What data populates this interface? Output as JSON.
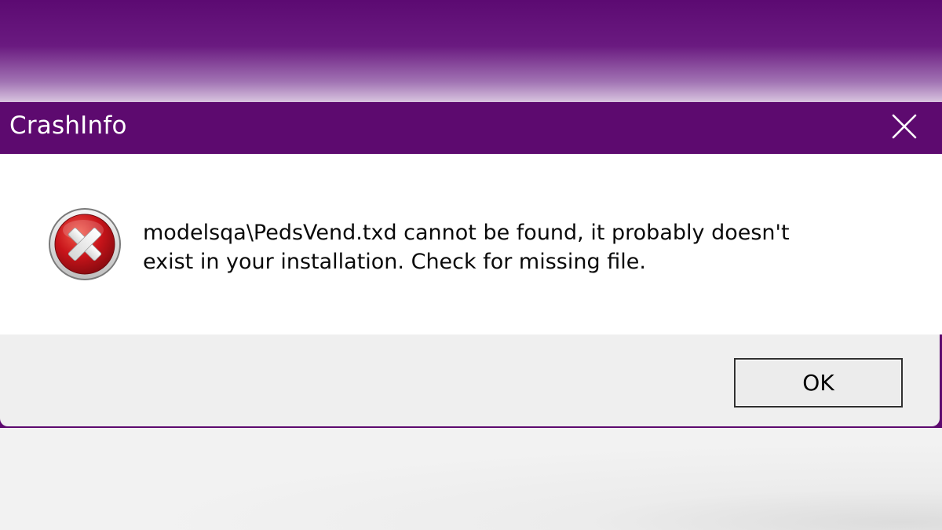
{
  "window": {
    "title": "CrashInfo",
    "close_icon": "close-icon",
    "accent_color": "#5d0a6f"
  },
  "message": {
    "icon": "error-icon",
    "text": "modelsqa\\PedsVend.txd cannot be found, it probably doesn't\nexist in your installation. Check for missing file."
  },
  "buttons": {
    "ok_label": "OK"
  }
}
